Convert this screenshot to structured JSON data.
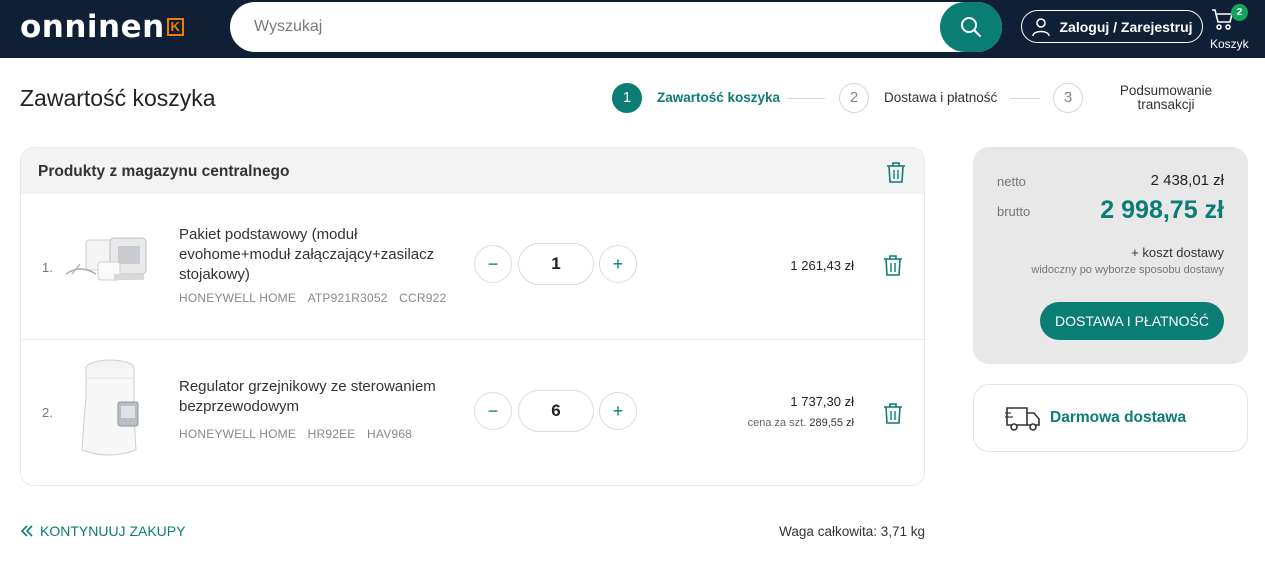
{
  "header": {
    "logo": "onninen",
    "logo_mark": "K",
    "search_placeholder": "Wyszukaj",
    "login_label": "Zaloguj / Zarejestruj",
    "cart_label": "Koszyk",
    "cart_count": "2"
  },
  "page": {
    "title": "Zawartość koszyka"
  },
  "steps": [
    {
      "number": "1",
      "label": "Zawartość koszyka",
      "active": true
    },
    {
      "number": "2",
      "label": "Dostawa i płatność",
      "active": false
    },
    {
      "number": "3",
      "label": "Podsumowanie transakcji",
      "active": false
    }
  ],
  "products": {
    "section_title": "Produkty z magazynu centralnego",
    "items": [
      {
        "index": "1.",
        "name": "Pakiet podstawowy (moduł evohome+moduł załączający+zasilacz stojakowy)",
        "brand": "HONEYWELL HOME",
        "code1": "ATP921R3052",
        "code2": "CCR922",
        "quantity": "1",
        "price": "1 261,43 zł"
      },
      {
        "index": "2.",
        "name": "Regulator grzejnikowy ze sterowaniem bezprzewodowym",
        "brand": "HONEYWELL HOME",
        "code1": "HR92EE",
        "code2": "HAV968",
        "quantity": "6",
        "price": "1 737,30 zł",
        "unit_price_label": "cena za szt.",
        "unit_price": "289,55 zł"
      }
    ]
  },
  "footer": {
    "continue_label": "KONTYNUUJ ZAKUPY",
    "weight_label": "Waga całkowita: 3,71 kg"
  },
  "summary": {
    "netto_label": "netto",
    "netto_value": "2 438,01 zł",
    "brutto_label": "brutto",
    "brutto_value": "2 998,75 zł",
    "shipping_label": "+ koszt dostawy",
    "shipping_note": "widoczny po wyborze sposobu dostawy",
    "checkout_label": "DOSTAWA I PŁATNOŚĆ",
    "free_shipping_label": "Darmowa dostawa"
  },
  "colors": {
    "header_bg": "#0e1f36",
    "accent": "#0a7d74",
    "logo_mark": "#f07d00",
    "badge": "#17a35c"
  },
  "qty_controls": {
    "minus": "−",
    "plus": "+"
  }
}
